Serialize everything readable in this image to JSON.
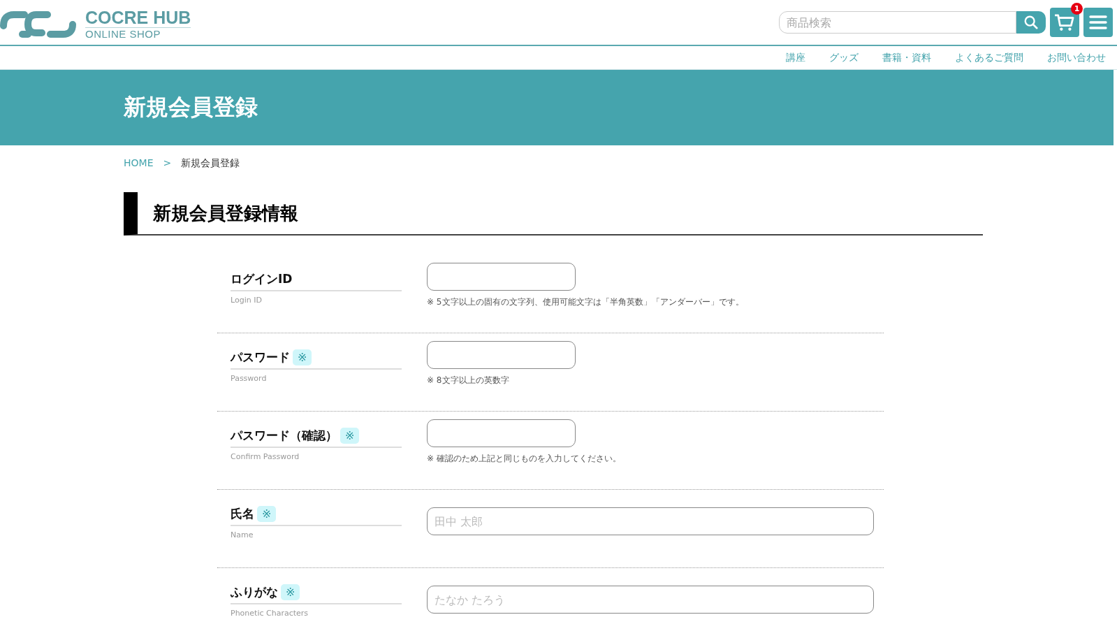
{
  "header": {
    "logo": {
      "title": "COCRE HUB",
      "subtitle": "ONLINE SHOP"
    },
    "search": {
      "placeholder": "商品検索"
    },
    "cart": {
      "count": "1"
    }
  },
  "nav": [
    {
      "label": "講座"
    },
    {
      "label": "グッズ"
    },
    {
      "label": "書籍・資料"
    },
    {
      "label": "よくあるご質問"
    },
    {
      "label": "お問い合わせ"
    }
  ],
  "banner": {
    "title": "新規会員登録"
  },
  "breadcrumb": [
    {
      "label": "HOME",
      "kind": "link"
    },
    {
      "label": ">",
      "kind": "separator"
    },
    {
      "label": "新規会員登録",
      "kind": "current"
    }
  ],
  "section": {
    "title": "新規会員登録情報"
  },
  "form": [
    {
      "label": "ログインID",
      "sublabel": "Login ID",
      "kind": "short",
      "note": "※  5文字以上の固有の文字列、使用可能文字は「半角英数」「アンダーバー」です。"
    },
    {
      "label": "パスワード",
      "sublabel": "Password",
      "required_mark": "※",
      "kind": "short",
      "note": "※  8文字以上の英数字"
    },
    {
      "label": "パスワード（確認）",
      "sublabel": "Confirm Password",
      "required_mark": "※",
      "kind": "short",
      "note": "※  確認のため上記と同じものを入力してください。"
    },
    {
      "label": "氏名",
      "sublabel": "Name",
      "required_mark": "※",
      "kind": "wide",
      "placeholder": "田中 太郎"
    },
    {
      "label": "ふりがな",
      "sublabel": "Phonetic Characters",
      "required_mark": "※",
      "kind": "wide",
      "placeholder": "たなか たろう"
    }
  ]
}
